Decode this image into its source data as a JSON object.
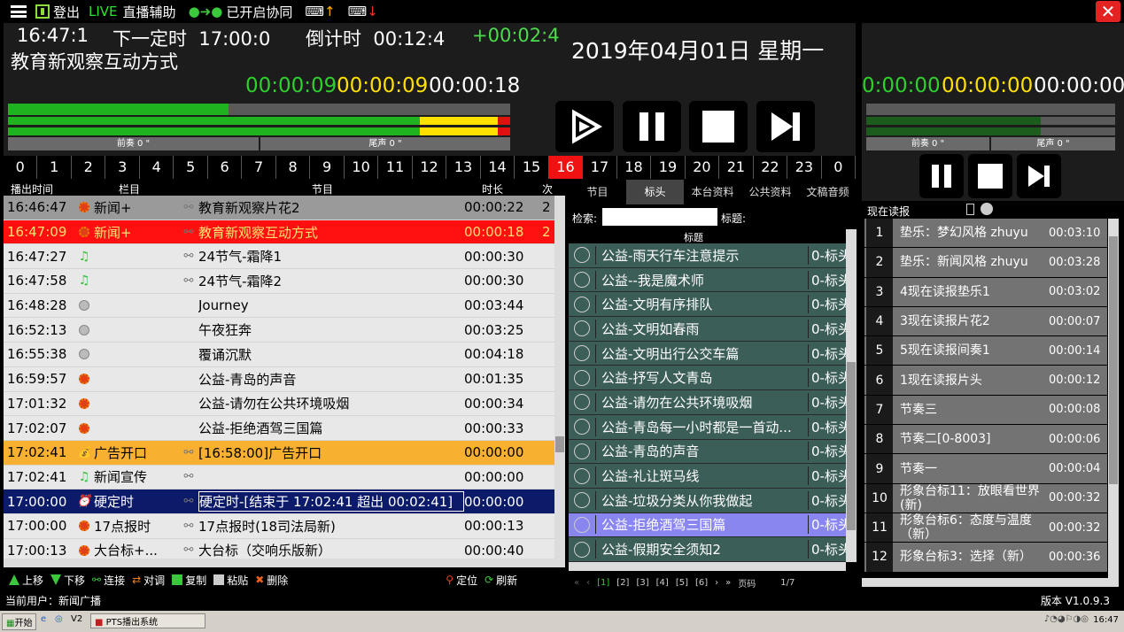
{
  "topbar": {
    "logout": "登出",
    "live": "LIVE",
    "assist": "直播辅助",
    "sync": "已开启协同"
  },
  "clock": {
    "now": "16:47:1",
    "next_label": "下一定时",
    "next_time": "17:00:0",
    "countdown_label": "倒计时",
    "countdown": "00:12:4",
    "diff": "+00:02:4",
    "date": "2019年04月01日 星期一"
  },
  "program_title": "教育新观察互动方式",
  "counters": {
    "green": "00:00:09",
    "yellow": "00:00:09",
    "white": "00:00:18"
  },
  "levels": {
    "progress": 0.44,
    "left_channel": 0.83,
    "right_channel": 0.83
  },
  "meter_labels": {
    "intro": "前奏 0 \"",
    "outro": "尾声 0 \""
  },
  "right_counters": {
    "green": "0:00:00",
    "yellow": "00:00:00",
    "white": "00:00:00"
  },
  "hours": [
    "0",
    "1",
    "2",
    "3",
    "4",
    "5",
    "6",
    "7",
    "8",
    "9",
    "10",
    "11",
    "12",
    "13",
    "14",
    "15",
    "16",
    "17",
    "18",
    "19",
    "20",
    "21",
    "22",
    "23",
    "0"
  ],
  "current_hour_index": 16,
  "playlist_header": {
    "time": "播出时间",
    "column": "栏目",
    "program": "节目",
    "duration": "时长",
    "count": "次"
  },
  "playlist": [
    {
      "time": "16:46:47",
      "icon": "gear",
      "column": "新闻+",
      "program": "教育新观察片花2",
      "duration": "00:00:22",
      "count": "2",
      "style": "gray"
    },
    {
      "time": "16:47:09",
      "icon": "gear",
      "column": "新闻+",
      "program": "教育新观察互动方式",
      "duration": "00:00:18",
      "count": "2",
      "style": "red"
    },
    {
      "time": "16:47:27",
      "icon": "note",
      "column": "",
      "program": "24节气-霜降1",
      "duration": "00:00:30",
      "count": "",
      "style": ""
    },
    {
      "time": "16:47:58",
      "icon": "note",
      "column": "",
      "program": "24节气-霜降2",
      "duration": "00:00:30",
      "count": "",
      "style": ""
    },
    {
      "time": "16:48:28",
      "icon": "disc",
      "column": "",
      "program": "Journey",
      "duration": "00:03:44",
      "count": "",
      "style": ""
    },
    {
      "time": "16:52:13",
      "icon": "disc",
      "column": "",
      "program": "午夜狂奔",
      "duration": "00:03:25",
      "count": "",
      "style": ""
    },
    {
      "time": "16:55:38",
      "icon": "disc",
      "column": "",
      "program": "覆诵沉默",
      "duration": "00:04:18",
      "count": "",
      "style": ""
    },
    {
      "time": "16:59:57",
      "icon": "gear",
      "column": "",
      "program": "公益-青岛的声音",
      "duration": "00:01:35",
      "count": "",
      "style": ""
    },
    {
      "time": "17:01:32",
      "icon": "gear",
      "column": "",
      "program": "公益-请勿在公共环境吸烟",
      "duration": "00:00:34",
      "count": "",
      "style": ""
    },
    {
      "time": "17:02:07",
      "icon": "gear",
      "column": "",
      "program": "公益-拒绝酒驾三国篇",
      "duration": "00:00:33",
      "count": "",
      "style": ""
    },
    {
      "time": "17:02:41",
      "icon": "bag",
      "column": "广告开口",
      "program": "[16:58:00]广告开口",
      "duration": "00:00:00",
      "count": "",
      "style": "orange"
    },
    {
      "time": "17:02:41",
      "icon": "note",
      "column": "新闻宣传",
      "program": "",
      "duration": "00:00:00",
      "count": "",
      "style": ""
    },
    {
      "time": "17:00:00",
      "icon": "clock",
      "column": "硬定时",
      "program": "硬定时-[结束于 17:02:41 超出 00:02:41]",
      "duration": "00:00:00",
      "count": "",
      "style": "navy"
    },
    {
      "time": "17:00:00",
      "icon": "gear",
      "column": "17点报时",
      "program": "17点报时(18司法局新)",
      "duration": "00:00:13",
      "count": "",
      "style": ""
    },
    {
      "time": "17:00:13",
      "icon": "gear",
      "column": "大台标+...",
      "program": "大台标（交响乐版新）",
      "duration": "00:00:40",
      "count": "",
      "style": ""
    }
  ],
  "toolbar": {
    "up": "上移",
    "down": "下移",
    "connect": "连接",
    "swap": "对调",
    "copy": "复制",
    "paste": "粘贴",
    "delete": "删除",
    "locate": "定位",
    "refresh": "刷新"
  },
  "mid_tabs": [
    "节目",
    "标头",
    "本台资料",
    "公共资料",
    "文稿音频"
  ],
  "mid_active_tab": 1,
  "search": {
    "label": "检索:",
    "title_label": "标题:"
  },
  "mid_header": "标题",
  "mid_list": [
    {
      "title": "公益-雨天行车注意提示",
      "cat": "0-标头"
    },
    {
      "title": "公益--我是魔术师",
      "cat": "0-标头"
    },
    {
      "title": "公益-文明有序排队",
      "cat": "0-标头"
    },
    {
      "title": "公益-文明如春雨",
      "cat": "0-标头"
    },
    {
      "title": "公益-文明出行公交车篇",
      "cat": "0-标头"
    },
    {
      "title": "公益-抒写人文青岛",
      "cat": "0-标头"
    },
    {
      "title": "公益-请勿在公共环境吸烟",
      "cat": "0-标头"
    },
    {
      "title": "公益-青岛每一小时都是一首动...",
      "cat": "0-标头"
    },
    {
      "title": "公益-青岛的声音",
      "cat": "0-标头"
    },
    {
      "title": "公益-礼让斑马线",
      "cat": "0-标头"
    },
    {
      "title": "公益-垃圾分类从你我做起",
      "cat": "0-标头"
    },
    {
      "title": "公益-拒绝酒驾三国篇",
      "cat": "0-标头",
      "selected": true
    },
    {
      "title": "公益-假期安全须知2",
      "cat": "0-标头"
    }
  ],
  "pager": {
    "pages": [
      "[1]",
      "[2]",
      "[3]",
      "[4]",
      "[5]",
      "[6]"
    ],
    "page_label": "页码",
    "page_info": "1/7"
  },
  "reading": {
    "label": "现在读报"
  },
  "reading_list": [
    {
      "n": "1",
      "title": "垫乐：梦幻风格 zhuyu",
      "dur": "00:03:10"
    },
    {
      "n": "2",
      "title": "垫乐：新闻风格 zhuyu",
      "dur": "00:03:28"
    },
    {
      "n": "3",
      "title": "4现在读报垫乐1",
      "dur": "00:03:02"
    },
    {
      "n": "4",
      "title": "3现在读报片花2",
      "dur": "00:00:07"
    },
    {
      "n": "5",
      "title": "5现在读报间奏1",
      "dur": "00:00:14"
    },
    {
      "n": "6",
      "title": "1现在读报片头",
      "dur": "00:00:12"
    },
    {
      "n": "7",
      "title": "节奏三",
      "dur": "00:00:08"
    },
    {
      "n": "8",
      "title": "节奏二[0-8003]",
      "dur": "00:00:06"
    },
    {
      "n": "9",
      "title": "节奏一",
      "dur": "00:00:04"
    },
    {
      "n": "10",
      "title": "形象台标11：放眼看世界(新)",
      "dur": "00:00:32"
    },
    {
      "n": "11",
      "title": "形象台标6：态度与温度（新）",
      "dur": "00:00:32"
    },
    {
      "n": "12",
      "title": "形象台标3：选择（新）",
      "dur": "00:00:36"
    }
  ],
  "status": {
    "user": "当前用户：新闻广播",
    "version": "版本 V1.0.9.3"
  },
  "taskbar": {
    "start": "开始",
    "task": "PTS播出系统",
    "clock": "16:47"
  }
}
